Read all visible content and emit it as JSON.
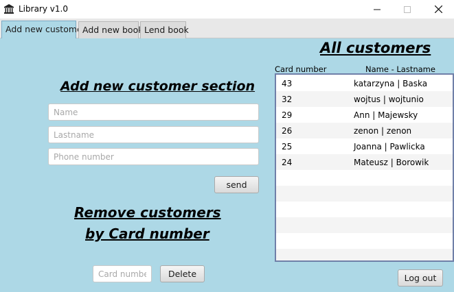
{
  "window": {
    "title": "Library v1.0"
  },
  "tabs": [
    {
      "label": "Add new customer",
      "active": true
    },
    {
      "label": "Add new book",
      "active": false
    },
    {
      "label": "Lend book",
      "active": false
    }
  ],
  "headings": {
    "all_customers": "All customers",
    "add_customer_section": "Add new customer section",
    "remove_line1": "Remove customers ",
    "remove_line2": "by Card number"
  },
  "form": {
    "name_placeholder": "Name",
    "lastname_placeholder": "Lastname",
    "phone_placeholder": "Phone number",
    "send_label": "send",
    "card_placeholder": "Card number",
    "delete_label": "Delete"
  },
  "customers_table": {
    "columns": [
      "Card number",
      "Name - Lastname"
    ],
    "rows": [
      {
        "card": "43",
        "name": "katarzyna | Baska"
      },
      {
        "card": "32",
        "name": "wojtus | wojtunio"
      },
      {
        "card": "29",
        "name": "Ann | Majewsky"
      },
      {
        "card": "26",
        "name": "zenon | zenon"
      },
      {
        "card": "25",
        "name": "Joanna | Pawlicka"
      },
      {
        "card": "24",
        "name": "Mateusz | Borowik"
      },
      {
        "card": "",
        "name": ""
      },
      {
        "card": "",
        "name": ""
      },
      {
        "card": "",
        "name": ""
      },
      {
        "card": "",
        "name": ""
      },
      {
        "card": "",
        "name": ""
      },
      {
        "card": "",
        "name": ""
      }
    ]
  },
  "footer": {
    "logout_label": "Log out"
  },
  "colors": {
    "content_background": "#add8e6",
    "active_tab": "#add8e6",
    "table_border": "#6f7fa8"
  },
  "icons": {
    "app": "library-building-icon",
    "minimize": "minimize-icon",
    "maximize": "maximize-icon",
    "close": "close-icon"
  }
}
